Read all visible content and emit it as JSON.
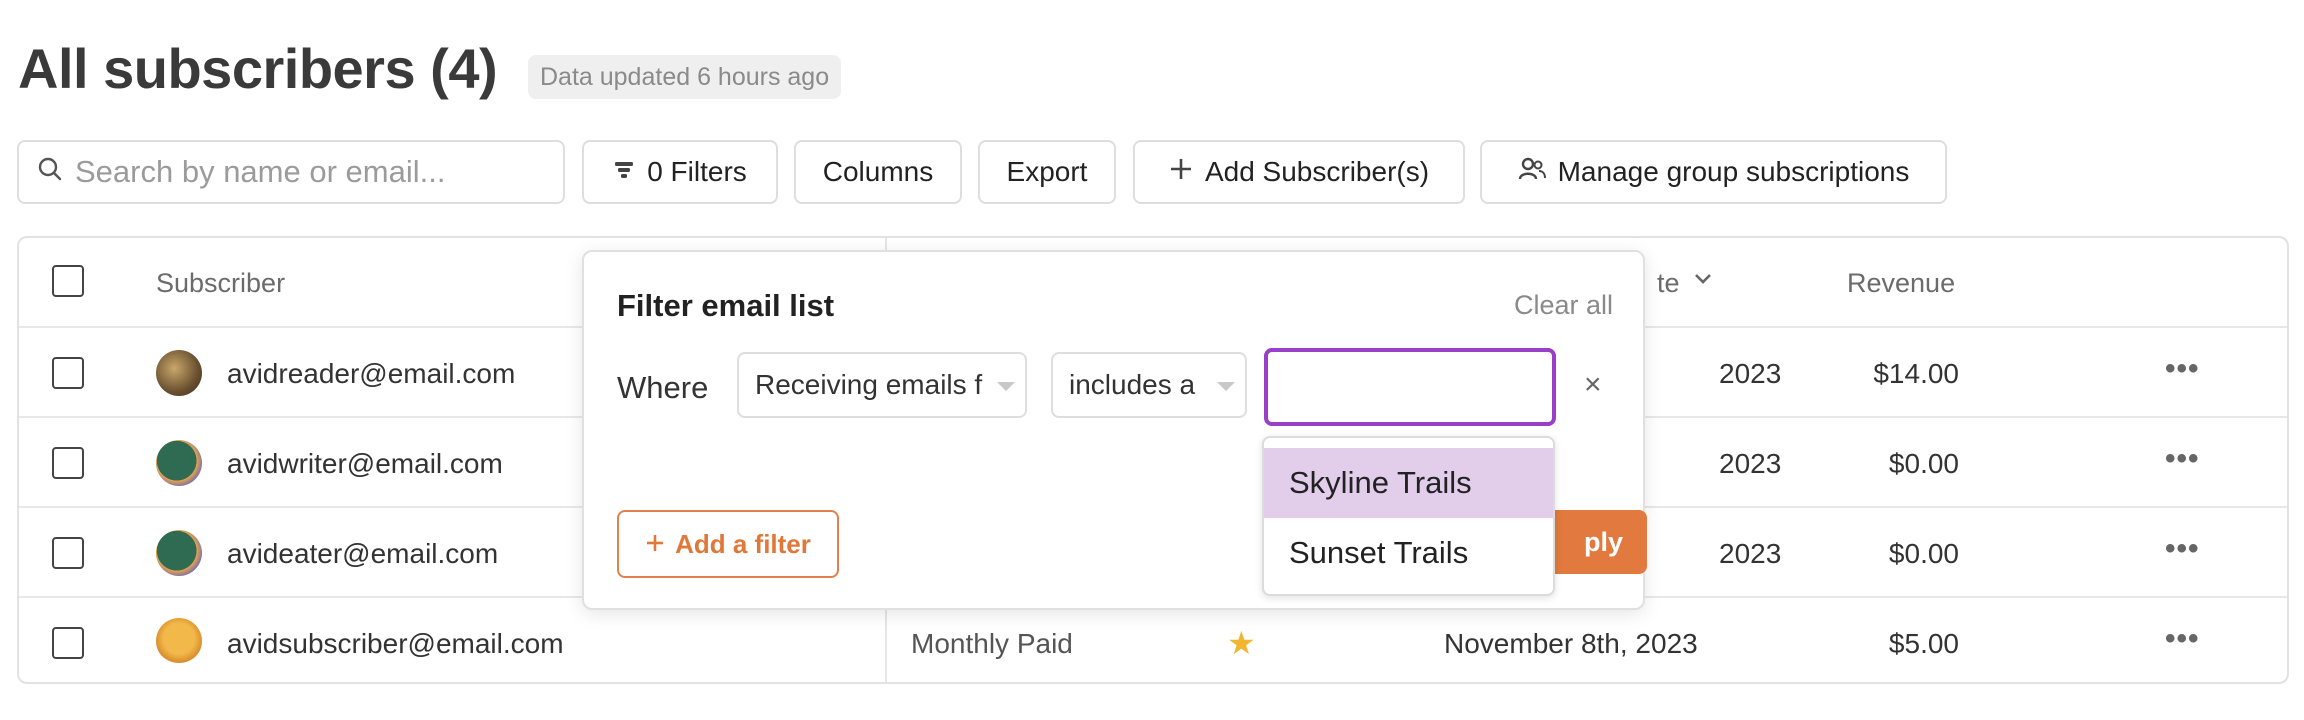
{
  "header": {
    "title": "All subscribers (4)",
    "updated": "Data updated 6 hours ago"
  },
  "toolbar": {
    "search_placeholder": "Search by name or email...",
    "filters_label": "0 Filters",
    "columns_label": "Columns",
    "export_label": "Export",
    "add_subscribers_label": "Add Subscriber(s)",
    "manage_groups_label": "Manage group subscriptions"
  },
  "table": {
    "headers": {
      "subscriber": "Subscriber",
      "date_partial": "te",
      "revenue": "Revenue"
    },
    "rows": [
      {
        "email": "avidreader@email.com",
        "type": "",
        "date": "2023",
        "revenue": "$14.00"
      },
      {
        "email": "avidwriter@email.com",
        "type": "",
        "date": "2023",
        "revenue": "$0.00"
      },
      {
        "email": "avideater@email.com",
        "type": "",
        "date": "2023",
        "revenue": "$0.00"
      },
      {
        "email": "avidsubscriber@email.com",
        "type": "Monthly Paid",
        "date": "November 8th, 2023",
        "revenue": "$5.00"
      }
    ],
    "more_glyph": "•••",
    "star_glyph": "★"
  },
  "filter_popover": {
    "title": "Filter email list",
    "clear_all": "Clear all",
    "where": "Where",
    "field_select": "Receiving emails f",
    "operator_select": "includes a",
    "value": "",
    "remove_glyph": "×",
    "add_filter": "Add a filter",
    "apply_partial": "ply"
  },
  "dropdown": {
    "options": [
      "Skyline Trails",
      "Sunset Trails"
    ],
    "highlighted_index": 0
  },
  "colors": {
    "accent_orange": "#e27a3f",
    "focus_purple": "#9a3fc7",
    "highlight_lavender": "#e2cdeb",
    "star_gold": "#f2b52f"
  }
}
